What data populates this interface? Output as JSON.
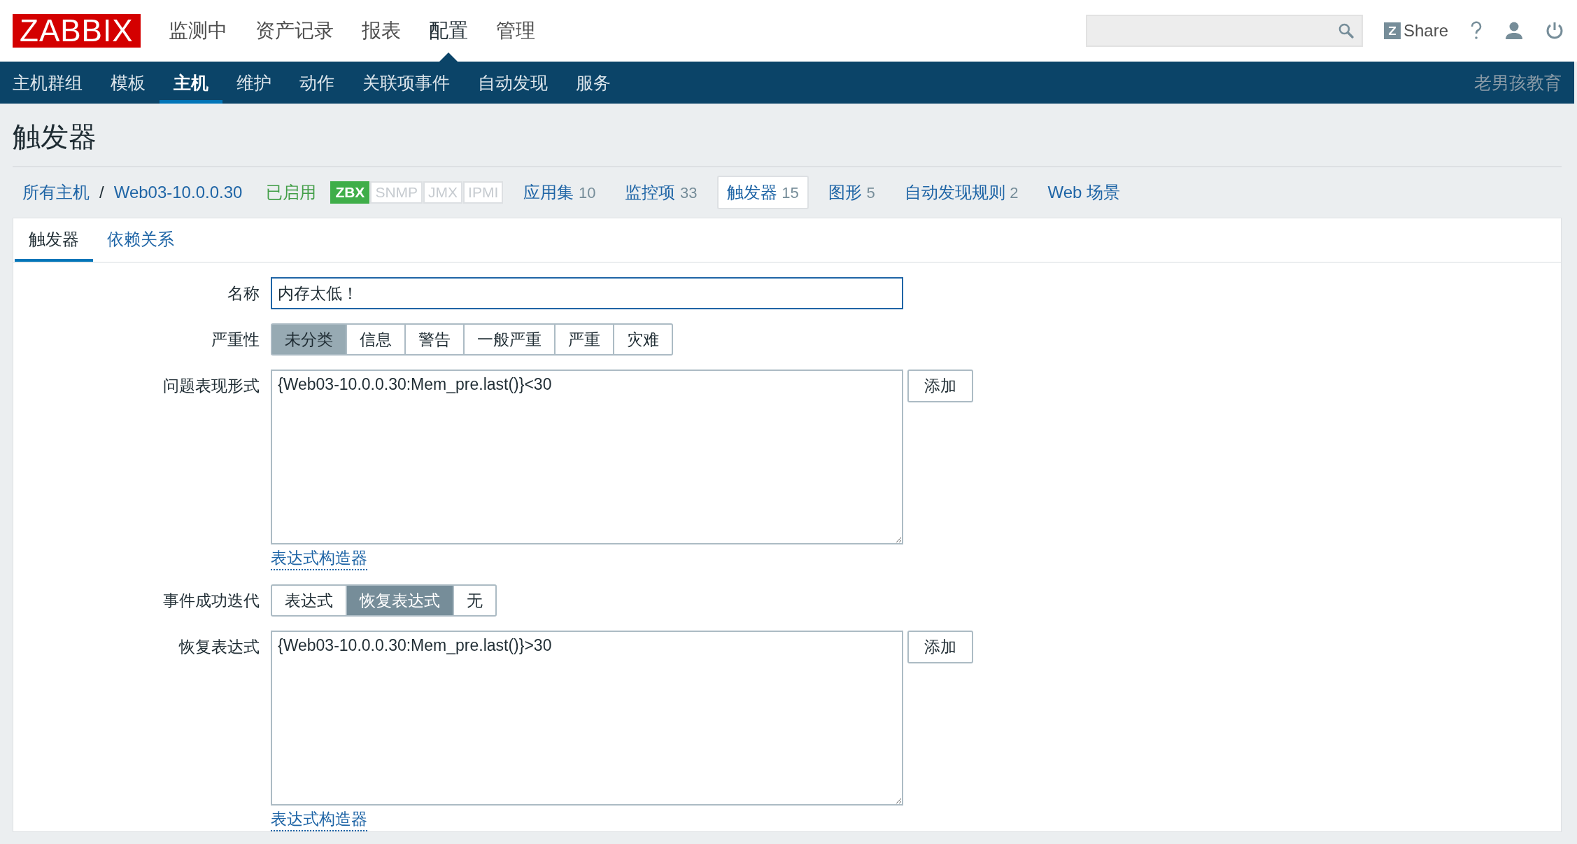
{
  "logo": "ZABBIX",
  "main_menu": [
    {
      "label": "监测中",
      "selected": false
    },
    {
      "label": "资产记录",
      "selected": false
    },
    {
      "label": "报表",
      "selected": false
    },
    {
      "label": "配置",
      "selected": true
    },
    {
      "label": "管理",
      "selected": false
    }
  ],
  "share": "Share",
  "sub_menu": [
    {
      "label": "主机群组",
      "selected": false
    },
    {
      "label": "模板",
      "selected": false
    },
    {
      "label": "主机",
      "selected": true
    },
    {
      "label": "维护",
      "selected": false
    },
    {
      "label": "动作",
      "selected": false
    },
    {
      "label": "关联项事件",
      "selected": false
    },
    {
      "label": "自动发现",
      "selected": false
    },
    {
      "label": "服务",
      "selected": false
    }
  ],
  "brand": "老男孩教育",
  "page_title": "触发器",
  "breadcrumb": {
    "items": [
      "所有主机",
      "Web03-10.0.0.30"
    ],
    "separator": "/"
  },
  "host_status": "已启用",
  "availability": [
    {
      "label": "ZBX",
      "active": true
    },
    {
      "label": "SNMP",
      "active": false
    },
    {
      "label": "JMX",
      "active": false
    },
    {
      "label": "IPMI",
      "active": false
    }
  ],
  "host_tabs": [
    {
      "label": "应用集",
      "count": "10",
      "selected": false
    },
    {
      "label": "监控项",
      "count": "33",
      "selected": false
    },
    {
      "label": "触发器",
      "count": "15",
      "selected": true
    },
    {
      "label": "图形",
      "count": "5",
      "selected": false
    },
    {
      "label": "自动发现规则",
      "count": "2",
      "selected": false
    },
    {
      "label": "Web 场景",
      "selected": false
    }
  ],
  "form_tabs": [
    {
      "label": "触发器",
      "selected": true
    },
    {
      "label": "依赖关系",
      "selected": false
    }
  ],
  "fields": [
    {
      "kind": "text",
      "label": "名称",
      "value": "内存太低！"
    },
    {
      "kind": "severity",
      "label": "严重性",
      "options": [
        {
          "label": "未分类",
          "selected": true
        },
        {
          "label": "信息",
          "selected": false
        },
        {
          "label": "警告",
          "selected": false
        },
        {
          "label": "一般严重",
          "selected": false
        },
        {
          "label": "严重",
          "selected": false
        },
        {
          "label": "灾难",
          "selected": false
        }
      ]
    },
    {
      "kind": "expression",
      "label": "问题表现形式",
      "value": "{Web03-10.0.0.30:Mem_pre.last()}<30",
      "button": "添加",
      "link": "表达式构造器"
    },
    {
      "kind": "radio",
      "label": "事件成功迭代",
      "options": [
        {
          "label": "表达式",
          "selected": false
        },
        {
          "label": "恢复表达式",
          "selected": true
        },
        {
          "label": "无",
          "selected": false
        }
      ]
    },
    {
      "kind": "expression",
      "label": "恢复表达式",
      "value": "{Web03-10.0.0.30:Mem_pre.last()}>30",
      "button": "添加",
      "link": "表达式构造器"
    }
  ]
}
